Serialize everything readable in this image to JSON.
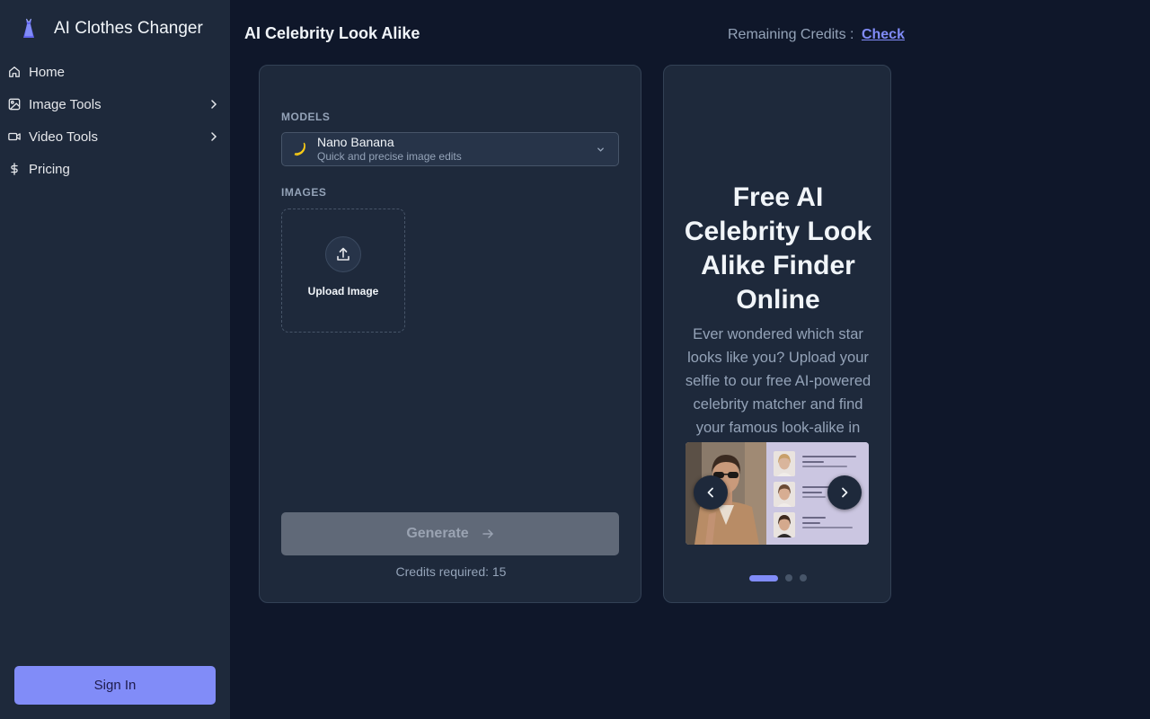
{
  "brand": {
    "name": "AI Clothes Changer",
    "logo_icon": "dress-logo-icon"
  },
  "sidebar": {
    "items": [
      {
        "label": "Home",
        "icon": "home-icon",
        "has_submenu": false
      },
      {
        "label": "Image Tools",
        "icon": "image-icon",
        "has_submenu": true
      },
      {
        "label": "Video Tools",
        "icon": "video-icon",
        "has_submenu": true
      },
      {
        "label": "Pricing",
        "icon": "dollar-icon",
        "has_submenu": false
      }
    ],
    "sign_in_label": "Sign In"
  },
  "header": {
    "title": "AI Celebrity Look Alike",
    "credits_label": "Remaining Credits :",
    "credits_link": "Check"
  },
  "form": {
    "models_label": "MODELS",
    "selected_model": {
      "name": "Nano Banana",
      "description": "Quick and precise image edits",
      "icon": "banana-icon"
    },
    "images_label": "IMAGES",
    "upload_label": "Upload Image",
    "generate_label": "Generate",
    "generate_enabled": false,
    "credits_required": "Credits required: 15"
  },
  "showcase": {
    "title": "Free AI Celebrity Look Alike Finder Online",
    "description": "Ever wondered which star looks like you? Upload your selfie to our free AI-powered celebrity matcher and find your famous look-alike in seconds.",
    "slide_count": 3,
    "active_slide": 1
  },
  "colors": {
    "accent": "#818cf8",
    "sidebar_bg": "#1e293b",
    "page_bg": "#0f172a",
    "panel_bg": "#1e293b"
  }
}
